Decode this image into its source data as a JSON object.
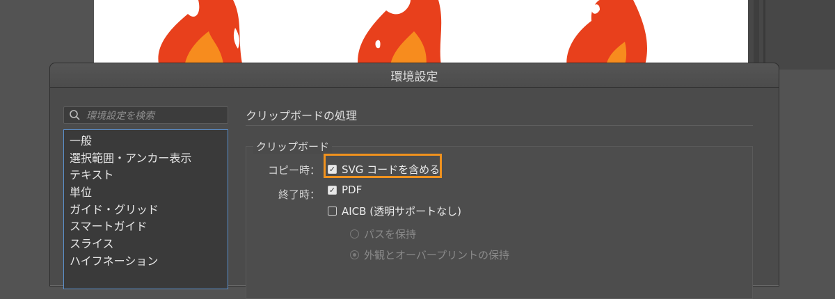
{
  "dialog": {
    "title": "環境設定",
    "search": {
      "placeholder": "環境設定を検索",
      "icon": "search-icon"
    },
    "categories": [
      "一般",
      "選択範囲・アンカー表示",
      "テキスト",
      "単位",
      "ガイド・グリッド",
      "スマートガイド",
      "スライス",
      "ハイフネーション"
    ],
    "section_title": "クリップボードの処理",
    "clipboard": {
      "group_label": "クリップボード",
      "copy_label": "コピー時：",
      "quit_label": "終了時：",
      "options": {
        "svg": {
          "label": "SVG コードを含める",
          "checked": true
        },
        "pdf": {
          "label": "PDF",
          "checked": true
        },
        "aicb": {
          "label": "AICB (透明サポートなし)",
          "checked": false
        }
      },
      "radios": {
        "keep_paths": {
          "label": "パスを保持",
          "selected": false
        },
        "keep_appearance": {
          "label": "外観とオーバープリントの保持",
          "selected": true
        }
      }
    },
    "colors": {
      "highlight": "#f0921e",
      "flame_outer": "#e8401c",
      "flame_inner": "#f78c1e"
    }
  }
}
